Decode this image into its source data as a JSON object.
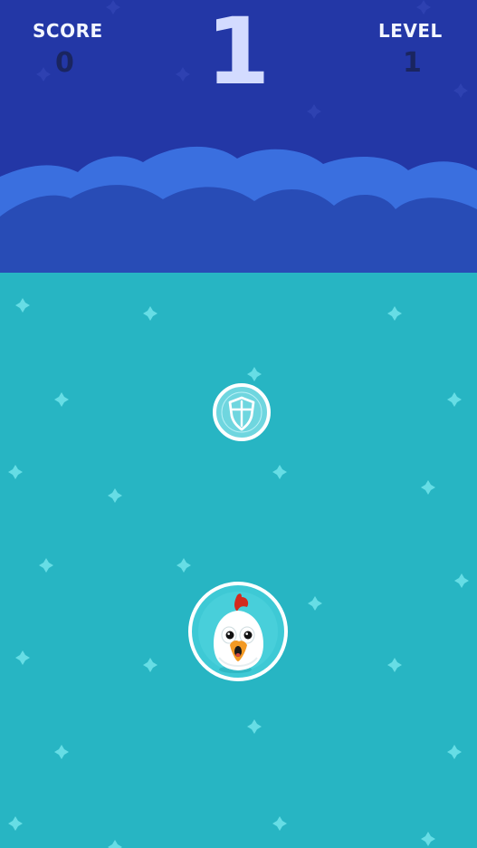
{
  "hud": {
    "score_label": "SCORE",
    "score_value": "0",
    "timer_value": "1",
    "level_label": "LEVEL",
    "level_value": "1"
  },
  "icons": {
    "powerup": "shield-icon",
    "player": "chicken-icon"
  },
  "colors": {
    "sky": "#2337a6",
    "cloud_front": "#284cb6",
    "cloud_back": "#3a6fdf",
    "field": "#27b5c3",
    "sparkle": "#66dde5",
    "bubble_ring": "#ffffff",
    "shield_fill": "#6fd6df",
    "text_light": "#f3f6ff",
    "text_dark": "#1a2560"
  }
}
